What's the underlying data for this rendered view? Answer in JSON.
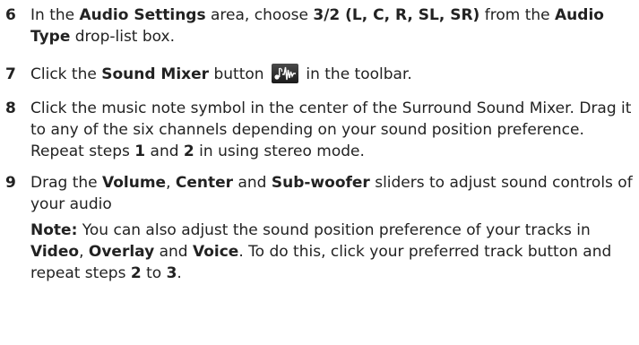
{
  "steps": [
    {
      "num": "6",
      "parts": [
        "In the ",
        "Audio Settings",
        " area, choose ",
        "3/2 (L, C, R, SL, SR)",
        " from the ",
        "Audio Type",
        " drop-list box."
      ]
    },
    {
      "num": "7",
      "parts": [
        "Click the ",
        "Sound Mixer",
        " button ",
        " in the toolbar."
      ],
      "icon": "sound-mixer-icon"
    },
    {
      "num": "8",
      "parts": [
        "Click the music note symbol in the center of the Surround Sound Mixer. Drag it to any of the six channels depending on your sound position preference. Repeat steps ",
        "1",
        " and ",
        "2",
        " in using stereo mode."
      ]
    },
    {
      "num": "9",
      "parts": [
        "Drag the ",
        "Volume",
        ", ",
        "Center",
        " and ",
        "Sub-woofer",
        " sliders to adjust sound controls of your audio"
      ],
      "note": {
        "label": "Note:",
        "parts": [
          " You can also adjust the sound position preference of your tracks in ",
          "Video",
          ", ",
          "Overlay",
          " and ",
          "Voice",
          ". To do this, click your preferred track button and repeat steps ",
          "2",
          " to ",
          "3",
          "."
        ]
      }
    }
  ]
}
